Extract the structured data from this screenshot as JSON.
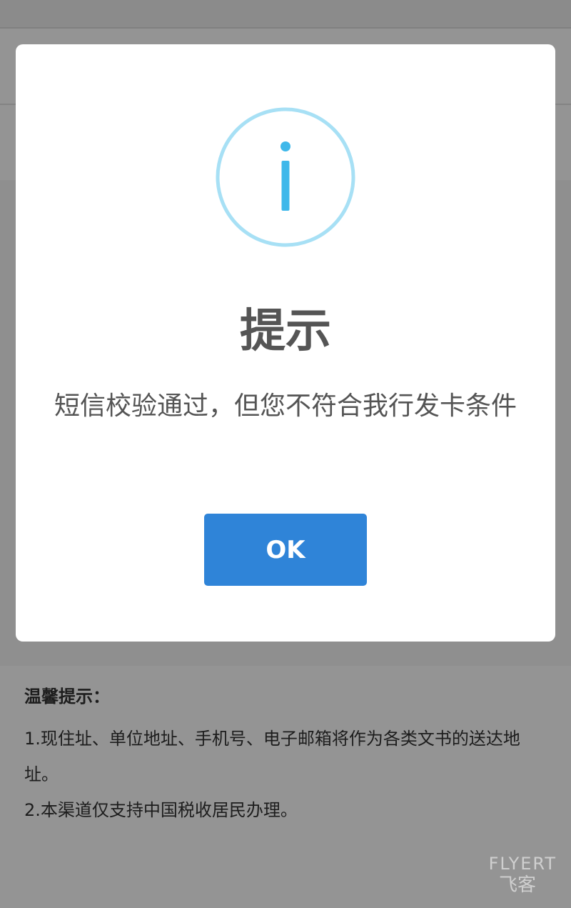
{
  "background": {
    "notice": {
      "title": "温馨提示：",
      "items": [
        "1.现住址、单位地址、手机号、电子邮箱将作为各类文书的送达地址。",
        "2.本渠道仅支持中国税收居民办理。"
      ]
    }
  },
  "modal": {
    "icon": "info-icon",
    "title": "提示",
    "message": "短信校验通过，但您不符合我行发卡条件",
    "ok_label": "OK"
  },
  "watermark": {
    "brand": "FLYERT",
    "sub": "飞客"
  },
  "colors": {
    "accent": "#2f84d8",
    "icon_circle": "#a7e0f5",
    "icon_i": "#3fb8ea",
    "overlay": "rgba(0,0,0,0.42)"
  }
}
